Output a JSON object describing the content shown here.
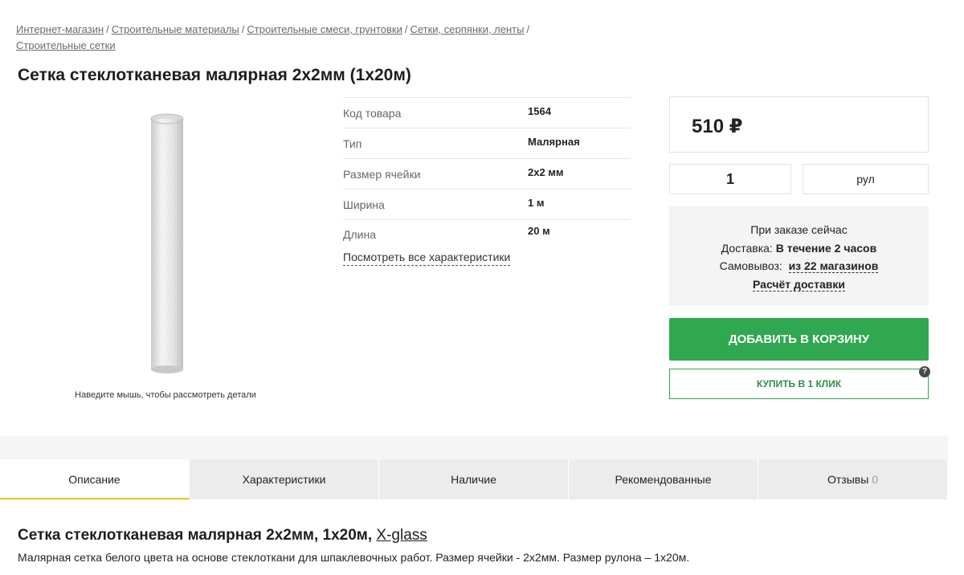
{
  "breadcrumb": {
    "items": [
      "Интернет-магазин",
      "Строительные материалы",
      "Строительные смеси, грунтовки",
      "Сетки, серпянки, ленты",
      "Строительные сетки"
    ],
    "separator": "/"
  },
  "product": {
    "title": "Сетка стеклотканевая малярная 2х2мм (1х20м)",
    "image_hint": "Наведите мышь, чтобы рассмотреть детали"
  },
  "specs": {
    "rows": [
      {
        "name": "Код товара",
        "value": "1564"
      },
      {
        "name": "Тип",
        "value": "Малярная"
      },
      {
        "name": "Размер ячейки",
        "value": "2х2 мм"
      },
      {
        "name": "Ширина",
        "value": "1 м"
      },
      {
        "name": "Длина",
        "value": "20 м"
      }
    ],
    "all_link": "Посмотреть все характеристики"
  },
  "buy": {
    "price": "510 ₽",
    "quantity": "1",
    "unit": "рул",
    "order_now": "При заказе сейчас",
    "delivery_label": "Доставка:",
    "delivery_value": "В течение 2 часов",
    "pickup_label": "Самовывоз:",
    "pickup_value": "из 22 магазинов",
    "calc_link": "Расчёт доставки",
    "add_to_cart": "ДОБАВИТЬ В КОРЗИНУ",
    "one_click": "КУПИТЬ В 1 КЛИК",
    "help_icon": "?"
  },
  "tabs": [
    {
      "label": "Описание",
      "count": ""
    },
    {
      "label": "Характеристики",
      "count": ""
    },
    {
      "label": "Наличие",
      "count": ""
    },
    {
      "label": "Рекомендованные",
      "count": ""
    },
    {
      "label": "Отзывы",
      "count": "0"
    }
  ],
  "description": {
    "title": "Сетка стеклотканевая малярная 2х2мм, 1х20м,",
    "brand": "X-glass",
    "text": "Малярная сетка белого цвета на основе стеклоткани для шпаклевочных работ. Размер ячейки - 2х2мм. Размер рулона – 1х20м."
  },
  "colors": {
    "accent_green": "#2fa84f",
    "active_tab_underline": "#f0c020"
  }
}
